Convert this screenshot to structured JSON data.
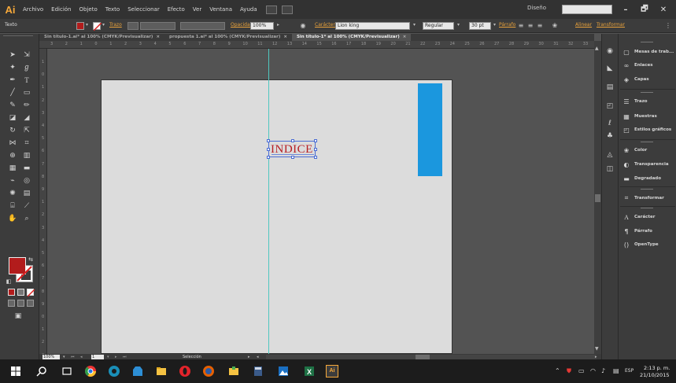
{
  "app": {
    "logo": "Ai",
    "menu": [
      "Archivo",
      "Edición",
      "Objeto",
      "Texto",
      "Seleccionar",
      "Efecto",
      "Ver",
      "Ventana",
      "Ayuda"
    ],
    "workspace": "Diseño",
    "window_controls": [
      "–",
      "🗗",
      "✕"
    ]
  },
  "control_bar": {
    "mode": "Texto",
    "fill_color": "#b21c1c",
    "stroke_link": "Trazo",
    "opacity_label": "Opacidad:",
    "opacity_value": "100%",
    "character_link": "Carácter:",
    "font_family": "Lion king",
    "font_style": "Regular",
    "font_size": "30 pt",
    "paragraph_link": "Párrafo",
    "align_link": "Alinear",
    "transform_link": "Transformar"
  },
  "tabs": [
    {
      "label": "Sin título-1.ai* al 100% (CMYK/Previsualizar)",
      "active": false
    },
    {
      "label": "propuesta 1.ai* al 100% (CMYK/Previsualizar)",
      "active": false
    },
    {
      "label": "Sin título-1* al 100% (CMYK/Previsualizar)",
      "active": true
    }
  ],
  "tab_close": "×",
  "ruler": {
    "h_ticks": [
      "3",
      "2",
      "1",
      "0",
      "1",
      "2",
      "3",
      "4",
      "5",
      "6",
      "7",
      "8",
      "9",
      "10",
      "11",
      "12",
      "13",
      "14",
      "15",
      "16",
      "17",
      "18",
      "19",
      "20",
      "21",
      "22",
      "23",
      "24",
      "25",
      "26",
      "27",
      "28",
      "29",
      "30",
      "31",
      "32",
      "33",
      "34"
    ],
    "v_ticks": [
      "1",
      "0",
      "1",
      "2",
      "3",
      "4",
      "5",
      "6",
      "7",
      "8",
      "9",
      "1",
      "2",
      "3",
      "4",
      "5",
      "6",
      "7",
      "8",
      "9",
      "0",
      "1",
      "2",
      "3"
    ]
  },
  "canvas": {
    "text_object": "INDICE",
    "text_color": "#b71e23",
    "rectangle_color": "#1b97de",
    "artboard_color": "#dcdcdc",
    "guide_color": "#4fc7c0"
  },
  "status_bar": {
    "zoom": "100%",
    "page": "1",
    "tool": "Selección"
  },
  "panels": [
    {
      "label": "Mesas de trab...",
      "icon": "artboards-icon"
    },
    {
      "label": "Enlaces",
      "icon": "links-icon"
    },
    {
      "label": "Capas",
      "icon": "layers-icon"
    },
    {
      "label": "Trazo",
      "icon": "stroke-icon"
    },
    {
      "label": "Muestras",
      "icon": "swatches-icon"
    },
    {
      "label": "Estilos gráficos",
      "icon": "graphic-styles-icon"
    },
    {
      "label": "Color",
      "icon": "color-icon"
    },
    {
      "label": "Transparencia",
      "icon": "transparency-icon"
    },
    {
      "label": "Degradado",
      "icon": "gradient-icon"
    },
    {
      "label": "Transformar",
      "icon": "transform-icon"
    },
    {
      "label": "Carácter",
      "icon": "character-icon"
    },
    {
      "label": "Párrafo",
      "icon": "paragraph-icon"
    },
    {
      "label": "OpenType",
      "icon": "opentype-icon"
    }
  ],
  "taskbar": {
    "language": "ESP",
    "time": "2:13 p. m.",
    "date": "21/10/2015",
    "active_app": "Ai"
  }
}
